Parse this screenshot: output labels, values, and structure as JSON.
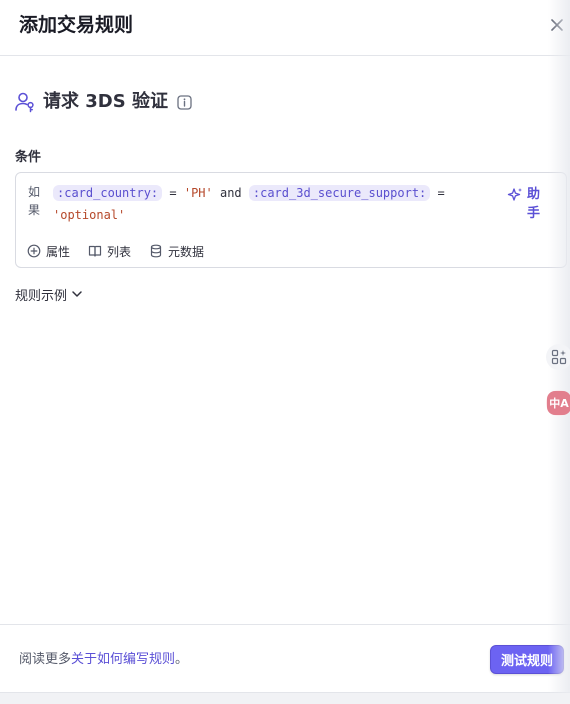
{
  "dialog": {
    "title": "添加交易规则",
    "close_icon": "close-icon"
  },
  "rule": {
    "icon": "user-key-icon",
    "title": "请求 3DS 验证",
    "info_icon": "info-icon"
  },
  "conditions": {
    "label": "条件",
    "if_label": "如果",
    "expression": {
      "field1": ":card_country:",
      "op1": " = ",
      "value1": "'PH'",
      "joiner": " and ",
      "field2": ":card_3d_secure_support:",
      "op2": " = ",
      "value2": "'optional'"
    },
    "assistant_label": "助手",
    "actions": [
      {
        "icon": "plus-circle-icon",
        "label": "属性"
      },
      {
        "icon": "book-icon",
        "label": "列表"
      },
      {
        "icon": "database-icon",
        "label": "元数据"
      }
    ]
  },
  "examples": {
    "label": "规则示例"
  },
  "side_tools": {
    "apps_icon": "apps-icon",
    "translate_label": "中A"
  },
  "footer": {
    "text_prefix": "阅读更多",
    "link_text": "关于如何编写规则",
    "text_suffix": "。",
    "test_button": "测试规则"
  },
  "colors": {
    "accent": "#6c63f2",
    "link": "#5b50d6",
    "token_bg": "#ebe9fb",
    "string_value": "#b5482a"
  }
}
